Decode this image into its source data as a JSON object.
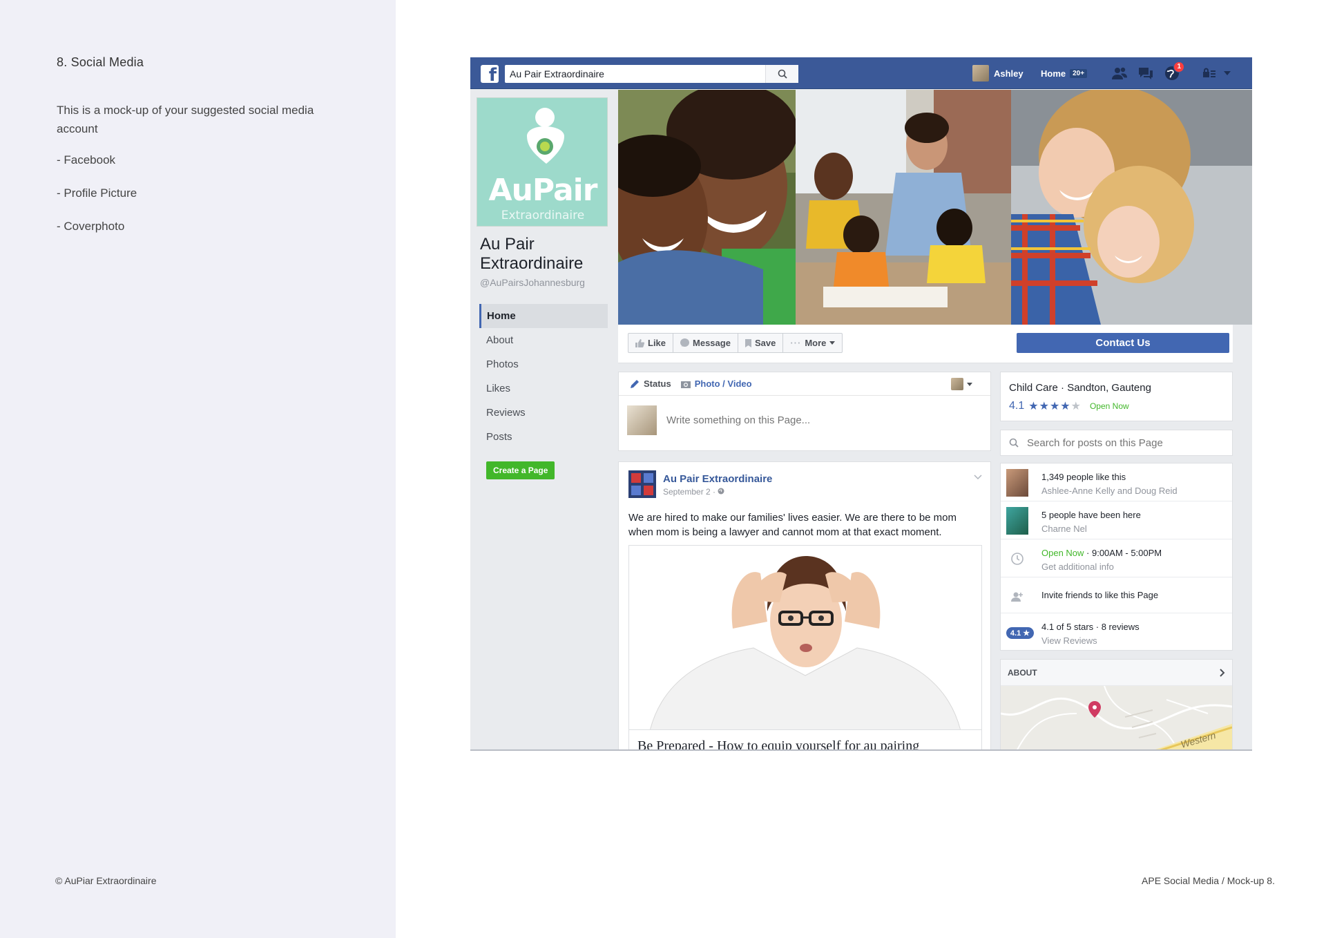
{
  "panel": {
    "section_title": "8. Social Media",
    "intro": "This is a mock-up of your suggested social media account",
    "bullets": [
      "- Facebook",
      "- Profile Picture",
      "- Coverphoto"
    ],
    "footer_left": "© AuPiar Extraordinaire",
    "footer_right": "APE Social Media / Mock-up  8."
  },
  "topbar": {
    "search_value": "Au Pair Extraordinaire",
    "user_name": "Ashley",
    "home_label": "Home",
    "home_count": "20+",
    "notification_count": "1",
    "icons": [
      "facebook-logo-icon",
      "search-icon",
      "friends-icon",
      "messages-icon",
      "globe-icon",
      "privacy-icon",
      "caret-down-icon"
    ]
  },
  "page": {
    "brand_main": "AuPair",
    "brand_sub": "Extraordinaire",
    "name": "Au Pair Extraordinaire",
    "handle": "@AuPairsJohannesburg",
    "nav": [
      "Home",
      "About",
      "Photos",
      "Likes",
      "Reviews",
      "Posts"
    ],
    "create_page": "Create a Page"
  },
  "actions": {
    "like": "Like",
    "message": "Message",
    "save": "Save",
    "more": "More",
    "contact": "Contact Us"
  },
  "composer": {
    "status_tab": "Status",
    "photo_tab": "Photo / Video",
    "placeholder": "Write something on this Page..."
  },
  "post": {
    "author": "Au Pair Extraordinaire",
    "date": "September 2 · ",
    "text": "We are hired to make our families' lives easier. We are there to be mom when mom is being a lawyer and cannot mom at that exact moment.",
    "link_title": "Be Prepared - How to equip yourself for au pairing"
  },
  "sidebar": {
    "category": "Child Care · Sandton, Gauteng",
    "rating": "4.1",
    "stars": "★★★★★",
    "rating_stars_filled": 4.1,
    "open_now": "Open Now",
    "search_placeholder": "Search for posts on this Page",
    "likes_line1": "1,349 people like this",
    "likes_line2": "Ashlee-Anne Kelly and Doug Reid",
    "visits_line1": "5 people have been here",
    "visits_line2": "Charne Nel",
    "hours_open": "Open Now",
    "hours_range": " · 9:00AM - 5:00PM",
    "hours_line2": "Get additional info",
    "invite": "Invite friends to like this Page",
    "rating_pill": "4.1 ★",
    "reviews_line1": "4.1 of 5 stars · 8 reviews",
    "reviews_line2": "View Reviews",
    "about_head": "ABOUT",
    "map_label": "Western"
  },
  "colors": {
    "fb_blue": "#3b5998",
    "button_blue": "#4267b2",
    "green": "#42b72a",
    "brand_teal": "#9ddacb",
    "panel_bg": "#f0f0f7"
  }
}
